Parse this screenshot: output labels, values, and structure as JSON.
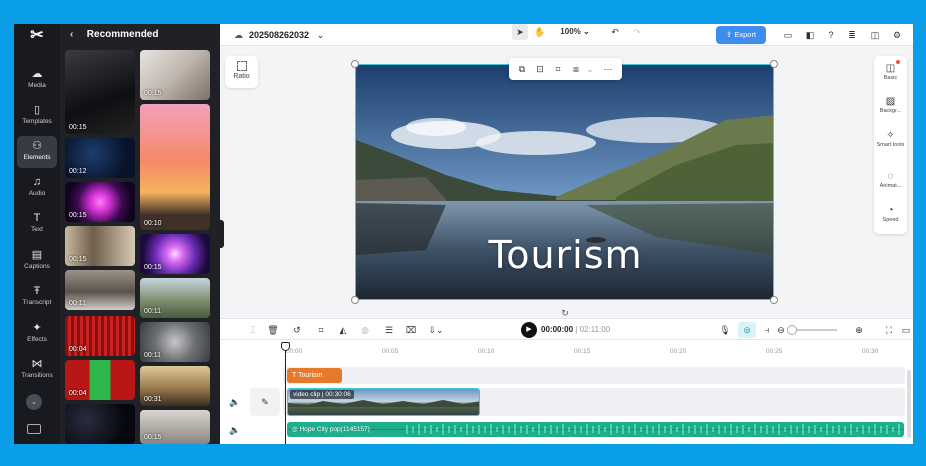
{
  "app": {
    "logo": "CapCut"
  },
  "rail": {
    "items": [
      {
        "icon": "media-icon",
        "label": "Media"
      },
      {
        "icon": "templates-icon",
        "label": "Templates"
      },
      {
        "icon": "elements-icon",
        "label": "Elements"
      },
      {
        "icon": "audio-icon",
        "label": "Audio"
      },
      {
        "icon": "text-icon",
        "label": "Text"
      },
      {
        "icon": "captions-icon",
        "label": "Captions"
      },
      {
        "icon": "transcript-icon",
        "label": "Transcript"
      },
      {
        "icon": "effects-icon",
        "label": "Effects"
      },
      {
        "icon": "transitions-icon",
        "label": "Transitions"
      }
    ],
    "active": "Elements"
  },
  "panel": {
    "title": "Recommended",
    "thumbs": [
      {
        "duration": "00:15"
      },
      {
        "duration": "00:15"
      },
      {
        "duration": "00:12"
      },
      {
        "duration": "00:10"
      },
      {
        "duration": "00:15"
      },
      {
        "duration": "00:15"
      },
      {
        "duration": "00:15"
      },
      {
        "duration": "00:11"
      },
      {
        "duration": "00:11"
      },
      {
        "duration": "00:04"
      },
      {
        "duration": "00:11"
      },
      {
        "duration": "00:04"
      },
      {
        "duration": "00:31"
      },
      {
        "duration": "00:15"
      }
    ]
  },
  "topbar": {
    "project_name": "202508262032",
    "zoom": "100%",
    "export_label": "Export"
  },
  "canvas": {
    "ratio_label": "Ratio",
    "overlay_text": "Tourism"
  },
  "right_panel": {
    "items": [
      {
        "icon": "basic-icon",
        "label": "Basic"
      },
      {
        "icon": "background-icon",
        "label": "Backgr..."
      },
      {
        "icon": "smart-tools-icon",
        "label": "Smart tools"
      },
      {
        "icon": "animation-icon",
        "label": "Animat..."
      },
      {
        "icon": "speed-icon",
        "label": "Speed"
      }
    ]
  },
  "playback": {
    "current": "00:00:00",
    "separator": "|",
    "total": "02:11:00"
  },
  "timeline": {
    "ticks": [
      "00:00",
      "00:05",
      "00:10",
      "00:15",
      "00:20",
      "00:25",
      "00:30"
    ],
    "text_clip": "Tourism",
    "video_clip": "video clip",
    "video_duration": "00:30:06",
    "audio_clip": "Hope City pop(1145157)"
  },
  "colors": {
    "accent": "#3f8cf0",
    "selection": "#3fc7d4",
    "text_clip": "#e57a2c",
    "audio_clip": "#1fae8b",
    "frame_bg": "#0a9ee8"
  }
}
